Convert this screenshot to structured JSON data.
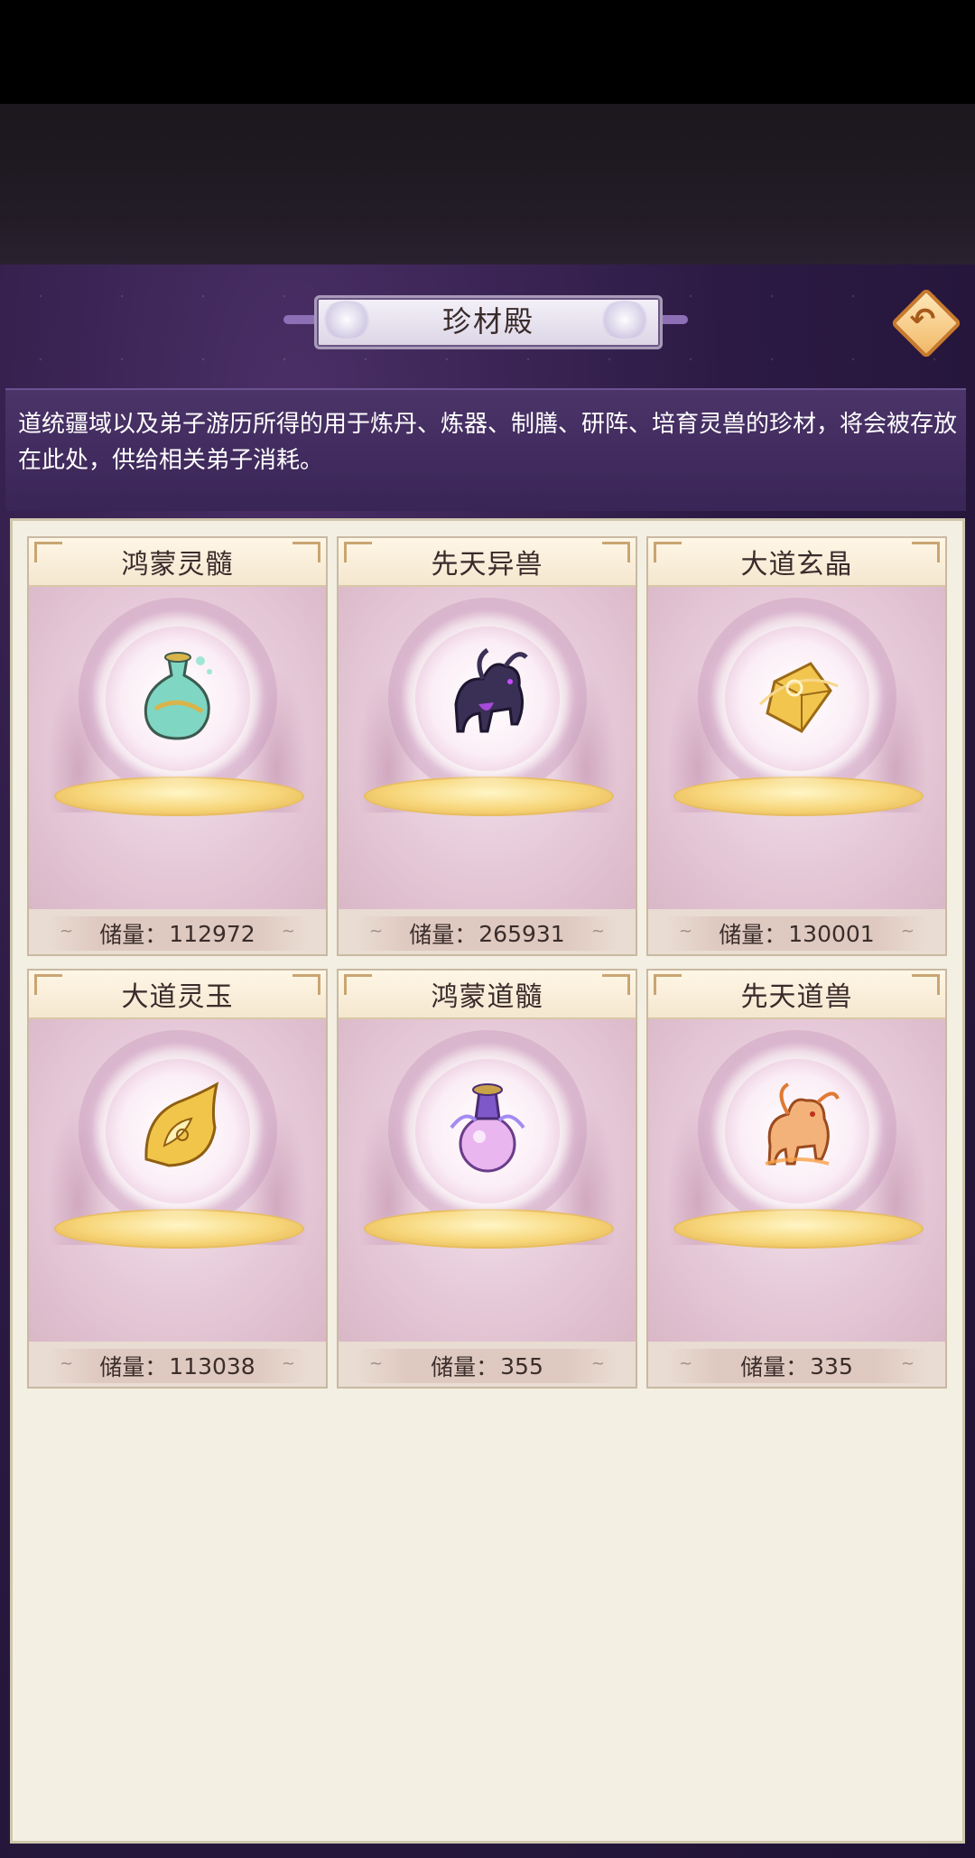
{
  "header": {
    "title": "珍材殿"
  },
  "description": "道统疆域以及弟子游历所得的用于炼丹、炼器、制膳、研阵、培育灵兽的珍材，将会被存放在此处，供给相关弟子消耗。",
  "stock_label": "储量：",
  "items": [
    {
      "name": "鸿蒙灵髓",
      "amount": "112972",
      "icon": "spirit-essence-vase-icon"
    },
    {
      "name": "先天异兽",
      "amount": "265931",
      "icon": "shadow-beast-icon"
    },
    {
      "name": "大道玄晶",
      "amount": "130001",
      "icon": "golden-crystal-icon"
    },
    {
      "name": "大道灵玉",
      "amount": "113038",
      "icon": "golden-jade-icon"
    },
    {
      "name": "鸿蒙道髓",
      "amount": "355",
      "icon": "orb-vase-icon"
    },
    {
      "name": "先天道兽",
      "amount": "335",
      "icon": "flame-beast-icon"
    }
  ],
  "colors": {
    "background": "#2c1a44",
    "panel": "#f3efe2",
    "accent_gold": "#e2b04b"
  }
}
